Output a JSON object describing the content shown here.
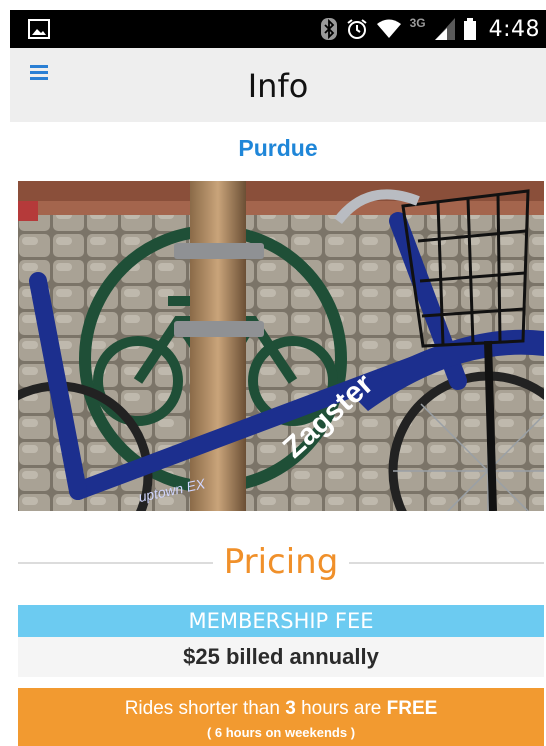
{
  "status_bar": {
    "time": "4:48",
    "network": "3G",
    "icons": [
      "image-icon",
      "bluetooth-icon",
      "alarm-icon",
      "wifi-icon",
      "signal-icon",
      "battery-icon"
    ]
  },
  "app_bar": {
    "title": "Info",
    "menu_icon": "hamburger-menu-icon",
    "accent_color": "#2a7fd4"
  },
  "location": {
    "name": "Purdue",
    "color": "#1f86d8"
  },
  "hero_image": {
    "brand_text": "Zagster",
    "frame_text": "uptown EX"
  },
  "pricing": {
    "heading": "Pricing",
    "heading_color": "#f0902a",
    "membership": {
      "label": "MEMBERSHIP FEE",
      "value": "$25 billed annually",
      "label_bg": "#6ccbf1"
    },
    "rides": {
      "prefix": "Rides shorter than ",
      "hours": "3",
      "middle": " hours are ",
      "free": "FREE",
      "weekend_note": "( 6 hours on weekends )",
      "bg": "#f29a30"
    }
  }
}
